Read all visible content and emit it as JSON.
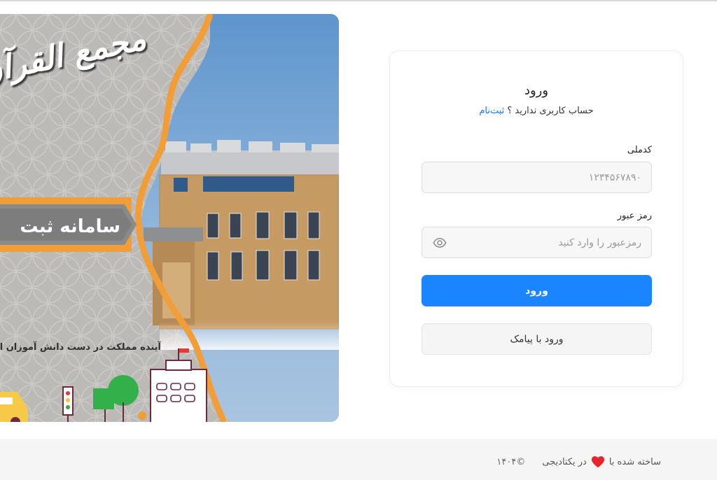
{
  "banner": {
    "title": "مجمع القرآن",
    "ribbon_text": "سامانه ثبت",
    "slogan": "آینده مملکت در دست دانش آموزان است. ("
  },
  "login": {
    "title": "ورود",
    "no_account_text": "حساب کاربری ندارید ؟",
    "register_link": "ثبت‌نام",
    "national_code_label": "کدملی",
    "national_code_placeholder": "۱۲۳۴۵۶۷۸۹۰",
    "password_label": "رمز عبور",
    "password_placeholder": "رمزعبور را وارد کنید",
    "submit_label": "ورود",
    "sms_login_label": "ورود با پیامک"
  },
  "footer": {
    "made_with": "ساخته شده با",
    "in_company": "در یکتادیجی",
    "copyright": "©۱۴۰۴"
  },
  "icons": {
    "password_toggle": "eye-icon",
    "footer_heart": "heart-icon"
  },
  "colors": {
    "primary": "#1b85ff",
    "link": "#1677ff",
    "heart": "#e8262a",
    "banner_orange": "#f29e38",
    "banner_sky": "#6d9ccc"
  }
}
